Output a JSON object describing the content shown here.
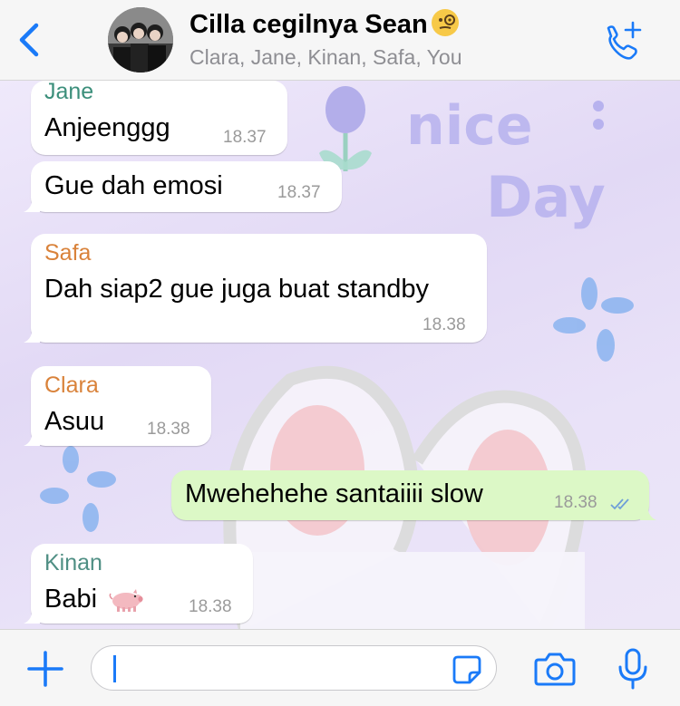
{
  "header": {
    "back_icon": "chevron-left-icon",
    "group_name": "Cilla cegilnya Sean",
    "title_emoji": "face-with-monocle",
    "members": "Clara, Jane, Kinan, Safa, You",
    "call_icon": "add-call-icon"
  },
  "messages": [
    {
      "sender": "Jane",
      "sender_color": "#3c8f7b",
      "text": "Anjeenggg",
      "time": "18.37"
    },
    {
      "sender": "",
      "text": "Gue dah emosi",
      "time": "18.37"
    },
    {
      "sender": "Safa",
      "sender_color": "#d9823a",
      "text": "Dah siap2 gue juga buat standby",
      "time": "18.38"
    },
    {
      "sender": "Clara",
      "sender_color": "#d9823a",
      "text": "Asuu",
      "time": "18.38"
    },
    {
      "sender": "You",
      "text": "Mwehehehe santaiiii slow",
      "time": "18.38",
      "read": true
    },
    {
      "sender": "Kinan",
      "sender_color": "#4f8f84",
      "text": "Babi",
      "emoji": "pig",
      "time": "18.38"
    }
  ],
  "input_bar": {
    "plus_icon": "plus-icon",
    "message_value": "",
    "sticker_icon": "sticker-icon",
    "camera_icon": "camera-icon",
    "mic_icon": "microphone-icon"
  },
  "colors": {
    "accent": "#1a7af8",
    "outgoing_bubble": "#dcf8c6",
    "incoming_bubble": "#ffffff"
  }
}
